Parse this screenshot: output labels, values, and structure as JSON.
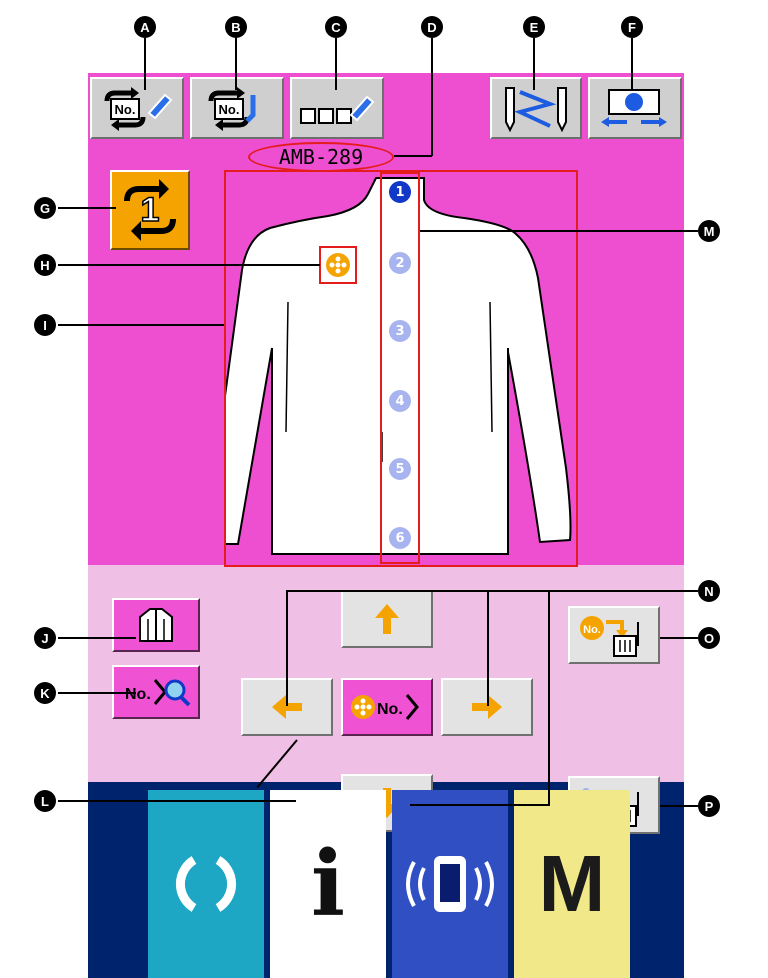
{
  "screen": {
    "pattern_name": "AMB-289",
    "colors": {
      "top_panel": "#ee4fd0",
      "mid_panel": "#efbfe5",
      "bottom_bar": "#00236e",
      "accent_orange": "#f5a300",
      "callout_red": "#e41c1c",
      "button_number_blue": "#1238c8"
    }
  },
  "toolbar": {
    "button_a_icon": "pattern-number-edit-icon",
    "button_b_icon": "pattern-number-list-icon",
    "button_c_icon": "name-input-icon",
    "button_c_text": "□□□",
    "button_e_icon": "thread-tension-icon",
    "button_f_icon": "presser-foot-icon",
    "counter_button_text": "1"
  },
  "buttons": {
    "button_no_text": "No.",
    "button_m_text": "M",
    "button_i_text": "i"
  },
  "callouts": {
    "a": "A",
    "b": "B",
    "c": "C",
    "d": "D",
    "e": "E",
    "f": "F",
    "g": "G",
    "h": "H",
    "i": "I",
    "j": "J",
    "k": "K",
    "l": "L",
    "m": "M",
    "n": "N",
    "o": "O",
    "p": "P"
  },
  "buttonhole_numbers": [
    "1",
    "2",
    "3",
    "4",
    "5",
    "6"
  ],
  "selected_buttonhole": "1",
  "bottom_bar": {
    "items": [
      {
        "name": "ready-key",
        "color": "#1ea7c4"
      },
      {
        "name": "information-key",
        "color": "#ffffff"
      },
      {
        "name": "communication-key",
        "color": "#2f4fc2"
      },
      {
        "name": "mode-key",
        "color": "#f1e88a"
      }
    ]
  }
}
